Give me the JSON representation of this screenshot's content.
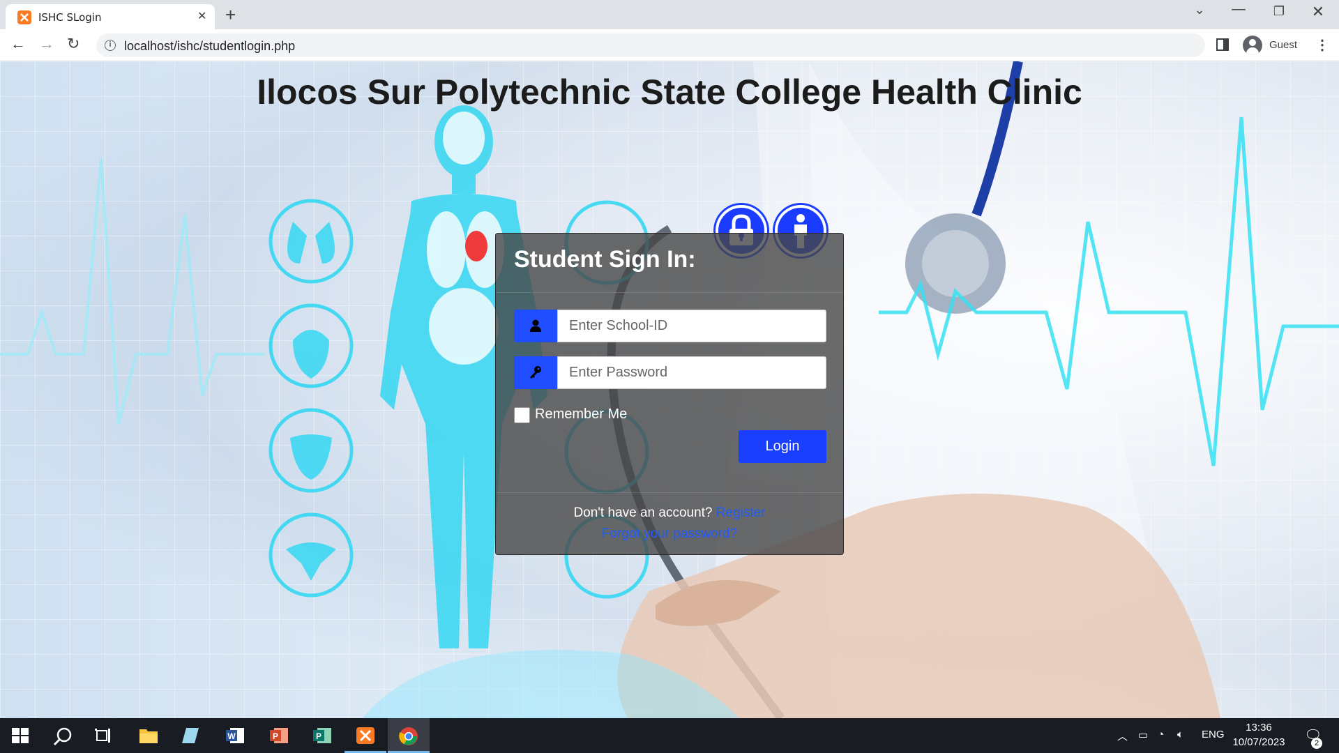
{
  "browser": {
    "tab_title": "ISHC SLogin",
    "tab_close": "✕",
    "new_tab": "+",
    "url": "localhost/ishc/studentlogin.php",
    "profile_name": "Guest"
  },
  "page": {
    "title": "Ilocos Sur Polytechnic State College Health Clinic"
  },
  "login": {
    "heading": "Student Sign In:",
    "school_id_placeholder": "Enter School-ID",
    "password_placeholder": "Enter Password",
    "remember_label": "Remember Me",
    "login_label": "Login",
    "account_prompt": "Don't have an account? ",
    "register_label": "Register",
    "forgot_label": "Forgot your password?"
  },
  "taskbar": {
    "lang": "ENG",
    "time": "13:36",
    "date": "10/07/2023",
    "notifications": "2"
  },
  "colors": {
    "accent": "#1f4dff",
    "panel": "#464646",
    "link": "#1e5cff"
  }
}
